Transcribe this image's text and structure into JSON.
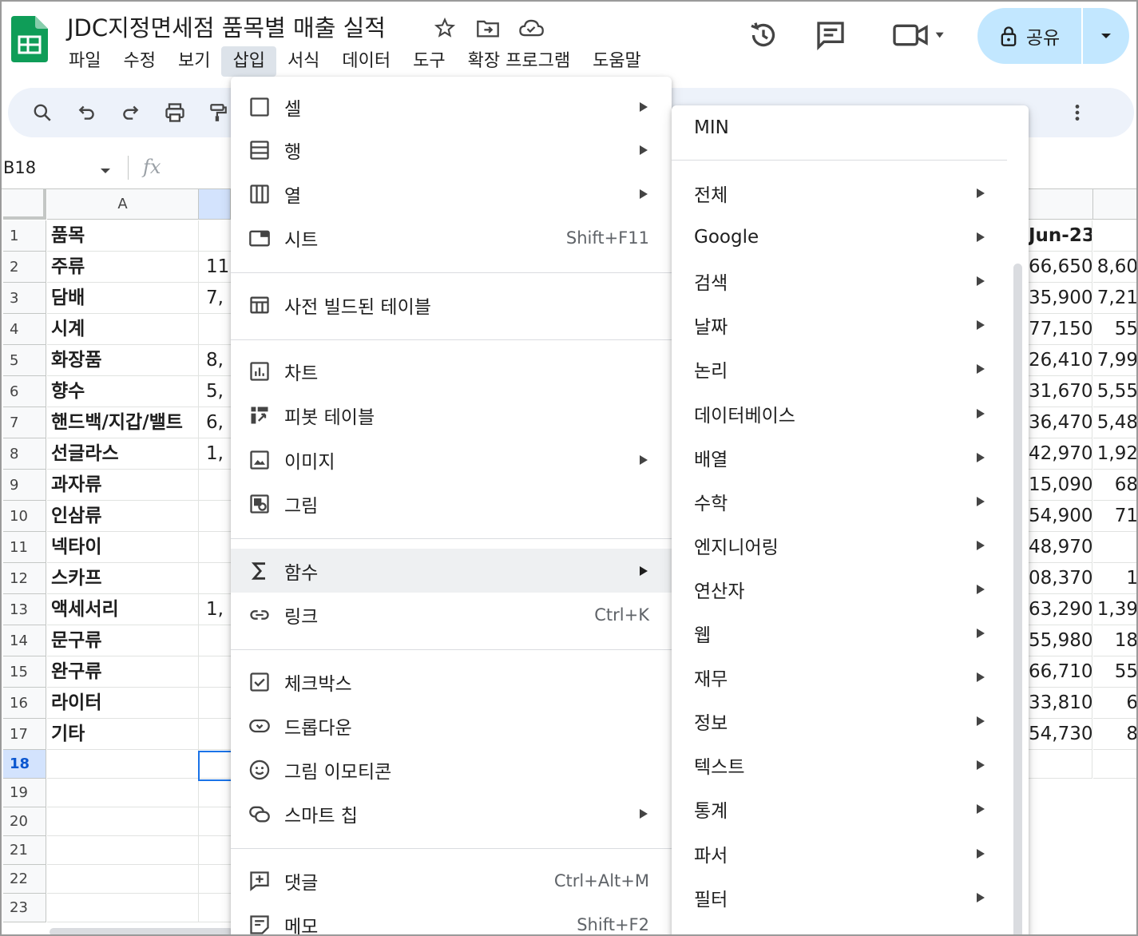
{
  "doc": {
    "title": "JDC지정면세점 품목별 매출 실적"
  },
  "menubar": [
    "파일",
    "수정",
    "보기",
    "삽입",
    "서식",
    "데이터",
    "도구",
    "확장 프로그램",
    "도움말"
  ],
  "share": {
    "label": "공유"
  },
  "formula_bar": {
    "cell_ref": "B18",
    "fx": "fx"
  },
  "grid": {
    "col_a_header": "A",
    "row_numbers": [
      "1",
      "2",
      "3",
      "4",
      "5",
      "6",
      "7",
      "8",
      "9",
      "10",
      "11",
      "12",
      "13",
      "14",
      "15",
      "16",
      "17",
      "18",
      "19",
      "20",
      "21",
      "22",
      "23"
    ],
    "col_a": [
      "품목",
      "주류",
      "담배",
      "시계",
      "화장품",
      "향수",
      "핸드백/지갑/밸트",
      "선글라스",
      "과자류",
      "인삼류",
      "넥타이",
      "스카프",
      "액세서리",
      "문구류",
      "완구류",
      "라이터",
      "기타"
    ],
    "col_b_partial": [
      "",
      "11,",
      "7,",
      "",
      "8,",
      "5,",
      "6,",
      "1,",
      "",
      "",
      "",
      "",
      "1,",
      "",
      "",
      "",
      ""
    ],
    "col_right1": [
      "Jun-23",
      "66,650",
      "35,900",
      "77,150",
      "26,410",
      "31,670",
      "36,470",
      "42,970",
      "15,090",
      "54,900",
      "48,970",
      "08,370",
      "63,290",
      "55,980",
      "66,710",
      "33,810",
      "54,730"
    ],
    "col_right2": [
      "",
      "8,60",
      "7,21",
      "55",
      "7,99",
      "5,55",
      "5,48",
      "1,92",
      "68",
      "71",
      "",
      "1",
      "1,39",
      "18",
      "55",
      "6",
      "8"
    ]
  },
  "insert_menu": {
    "items": [
      {
        "label": "셀",
        "icon": "cell-icon",
        "submenu": true
      },
      {
        "label": "행",
        "icon": "row-icon",
        "submenu": true
      },
      {
        "label": "열",
        "icon": "column-icon",
        "submenu": true
      },
      {
        "label": "시트",
        "icon": "sheet-icon",
        "shortcut": "Shift+F11"
      },
      {
        "label": "사전 빌드된 테이블",
        "icon": "table-icon"
      },
      {
        "label": "차트",
        "icon": "chart-icon"
      },
      {
        "label": "피봇 테이블",
        "icon": "pivot-icon"
      },
      {
        "label": "이미지",
        "icon": "image-icon",
        "submenu": true
      },
      {
        "label": "그림",
        "icon": "drawing-icon"
      },
      {
        "label": "함수",
        "icon": "sigma-icon",
        "submenu": true,
        "highlighted": true
      },
      {
        "label": "링크",
        "icon": "link-icon",
        "shortcut": "Ctrl+K"
      },
      {
        "label": "체크박스",
        "icon": "checkbox-icon"
      },
      {
        "label": "드롭다운",
        "icon": "dropdown-icon"
      },
      {
        "label": "그림 이모티콘",
        "icon": "emoji-icon"
      },
      {
        "label": "스마트 칩",
        "icon": "smart-chip-icon",
        "submenu": true
      },
      {
        "label": "댓글",
        "icon": "comment-icon",
        "shortcut": "Ctrl+Alt+M"
      },
      {
        "label": "메모",
        "icon": "note-icon",
        "shortcut": "Shift+F2"
      }
    ]
  },
  "function_menu": {
    "recent": "MIN",
    "categories": [
      "전체",
      "Google",
      "검색",
      "날짜",
      "논리",
      "데이터베이스",
      "배열",
      "수학",
      "엔지니어링",
      "연산자",
      "웹",
      "재무",
      "정보",
      "텍스트",
      "통계",
      "파서",
      "필터"
    ]
  }
}
